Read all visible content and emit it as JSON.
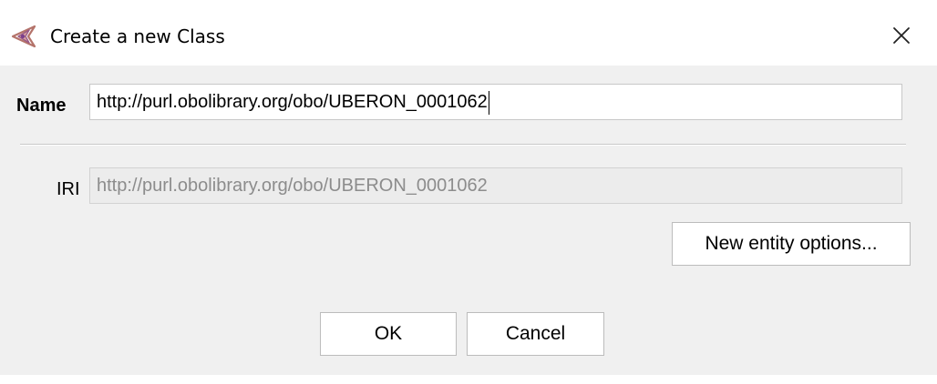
{
  "window": {
    "title": "Create a new Class",
    "icon": "protege-app-icon",
    "close_icon": "close-icon"
  },
  "form": {
    "name_label": "Name",
    "name_value": "http://purl.obolibrary.org/obo/UBERON_0001062",
    "iri_label": "IRI",
    "iri_value": "http://purl.obolibrary.org/obo/UBERON_0001062"
  },
  "buttons": {
    "entity_options": "New entity options...",
    "ok": "OK",
    "cancel": "Cancel"
  },
  "colors": {
    "content_background": "#f0f0f0",
    "disabled_text": "#8c8c8c"
  }
}
